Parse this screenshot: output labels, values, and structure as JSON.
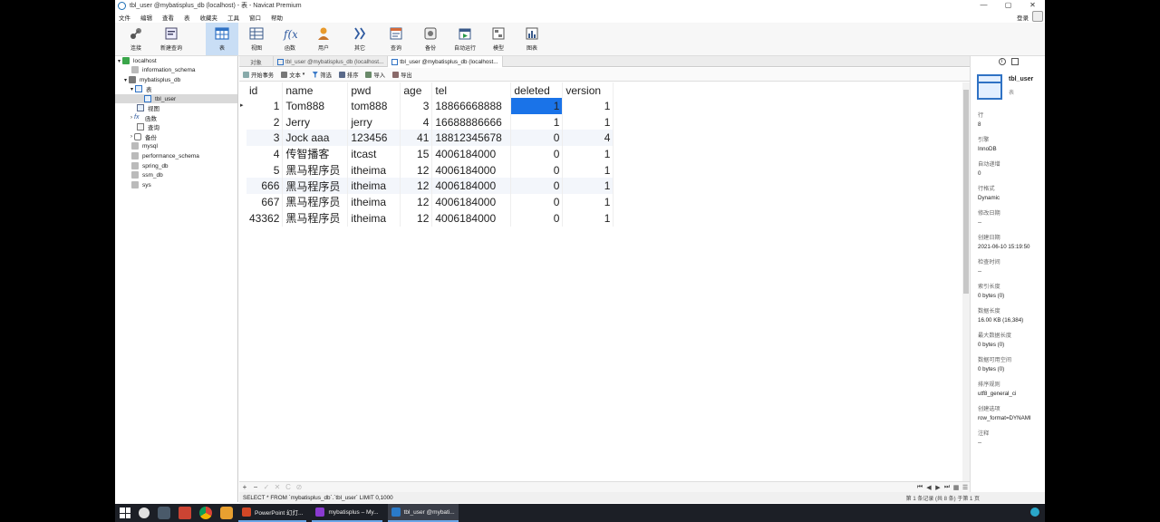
{
  "window": {
    "title": "tbl_user @mybatisplus_db (localhost) - 表 - Navicat Premium",
    "controls": [
      "—",
      "▢",
      "✕"
    ]
  },
  "menu": {
    "items": [
      "文件",
      "编辑",
      "查看",
      "表",
      "收藏夹",
      "工具",
      "窗口",
      "帮助"
    ],
    "login": "登录"
  },
  "toolbar": {
    "buttons": [
      {
        "label": "连接",
        "icon": "connection-icon"
      },
      {
        "label": "新建查询",
        "icon": "new-query-icon"
      },
      {
        "label": "表",
        "icon": "table-icon"
      },
      {
        "label": "视图",
        "icon": "view-icon"
      },
      {
        "label": "函数",
        "icon": "function-icon"
      },
      {
        "label": "用户",
        "icon": "user-icon"
      },
      {
        "label": "其它",
        "icon": "other-icon"
      },
      {
        "label": "查询",
        "icon": "query-icon"
      },
      {
        "label": "备份",
        "icon": "backup-icon"
      },
      {
        "label": "自动运行",
        "icon": "auto-run-icon"
      },
      {
        "label": "模型",
        "icon": "model-icon"
      },
      {
        "label": "图表",
        "icon": "chart-icon"
      }
    ]
  },
  "sidebar": {
    "connection": "localhost",
    "items": [
      {
        "label": "information_schema"
      },
      {
        "label": "mybatisplus_db"
      },
      {
        "label": "表"
      },
      {
        "label": "tbl_user"
      },
      {
        "label": "视图"
      },
      {
        "label": "函数"
      },
      {
        "label": "查询"
      },
      {
        "label": "备份"
      },
      {
        "label": "mysql"
      },
      {
        "label": "performance_schema"
      },
      {
        "label": "spring_db"
      },
      {
        "label": "ssm_db"
      },
      {
        "label": "sys"
      }
    ]
  },
  "tabs": {
    "object": "对象",
    "tab1": "tbl_user @mybatisplus_db (localhost...",
    "tab2": "tbl_user @mybatisplus_db (localhost..."
  },
  "subtoolbar": {
    "begin_transaction": "开始事务",
    "text": "文本",
    "filter": "筛选",
    "sort": "排序",
    "import": "导入",
    "export": "导出"
  },
  "grid": {
    "columns": [
      "id",
      "name",
      "pwd",
      "age",
      "tel",
      "deleted",
      "version"
    ],
    "rows": [
      [
        "1",
        "Tom888",
        "tom888",
        "3",
        "18866668888",
        "1",
        "1"
      ],
      [
        "2",
        "Jerry",
        "jerry",
        "4",
        "16688886666",
        "1",
        "1"
      ],
      [
        "3",
        "Jock aaa",
        "123456",
        "41",
        "18812345678",
        "0",
        "4"
      ],
      [
        "4",
        "传智播客",
        "itcast",
        "15",
        "4006184000",
        "0",
        "1"
      ],
      [
        "5",
        "黑马程序员",
        "itheima",
        "12",
        "4006184000",
        "0",
        "1"
      ],
      [
        "666",
        "黑马程序员",
        "itheima",
        "12",
        "4006184000",
        "0",
        "1"
      ],
      [
        "667",
        "黑马程序员",
        "itheima",
        "12",
        "4006184000",
        "0",
        "1"
      ],
      [
        "43362",
        "黑马程序员",
        "itheima",
        "12",
        "4006184000",
        "0",
        "1"
      ]
    ],
    "row_marker": "▸"
  },
  "bottom_controls": [
    "+",
    "−",
    "✓",
    "✕",
    "C",
    "⊘"
  ],
  "status": {
    "sql": "SELECT * FROM `mybatisplus_db`.`tbl_user` LIMIT 0,1000",
    "record": "第 1 条记录 (共 8 条) 于第 1 页"
  },
  "info_panel": {
    "name": "tbl_user",
    "type": "表",
    "properties": [
      {
        "label": "行",
        "value": "8"
      },
      {
        "label": "引擎",
        "value": "InnoDB"
      },
      {
        "label": "自动递增",
        "value": "0"
      },
      {
        "label": "行格式",
        "value": "Dynamic"
      },
      {
        "label": "修改日期",
        "value": "--"
      },
      {
        "label": "创建日期",
        "value": "2021-06-10 15:19:50"
      },
      {
        "label": "检查时间",
        "value": "--"
      },
      {
        "label": "索引长度",
        "value": "0 bytes (0)"
      },
      {
        "label": "数据长度",
        "value": "16.00 KB (16,384)"
      },
      {
        "label": "最大数据长度",
        "value": "0 bytes (0)"
      },
      {
        "label": "数据可用空间",
        "value": "0 bytes (0)"
      },
      {
        "label": "排序规则",
        "value": "utf8_general_ci"
      },
      {
        "label": "创建选项",
        "value": "row_format=DYNAMI"
      },
      {
        "label": "注释",
        "value": "--"
      }
    ]
  },
  "taskbar": {
    "apps": [
      "PowerPoint 幻灯...",
      "mybatisplus – My...",
      "tbl_user @mybati..."
    ]
  },
  "colors": {
    "selection": "#1a73e8",
    "toolbar_active": "#c9def5",
    "taskbar": "#1c1f26"
  }
}
